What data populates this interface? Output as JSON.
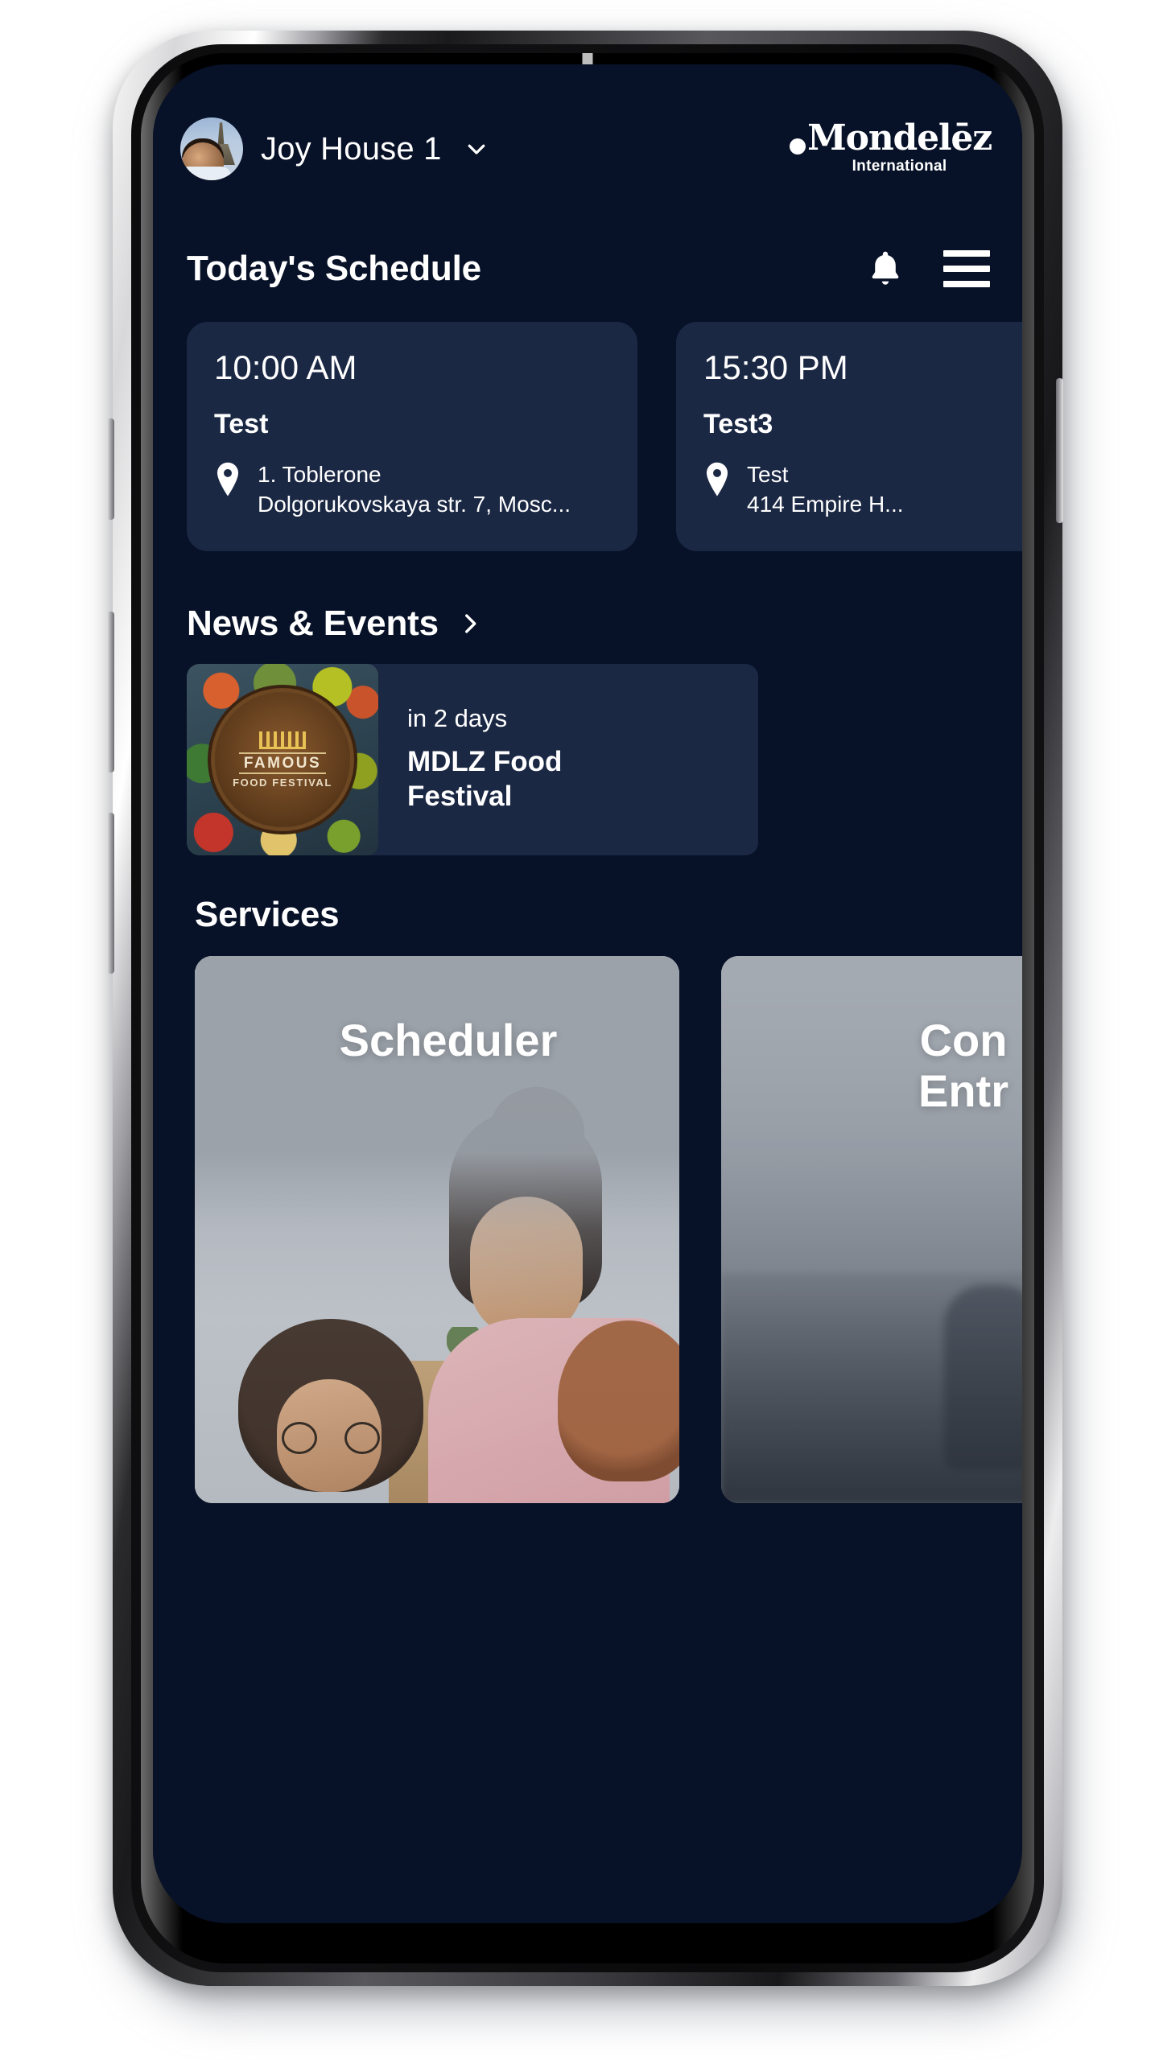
{
  "header": {
    "house_name": "Joy House 1",
    "chevron_icon": "chevron-down-icon",
    "avatar_icon": "user-avatar",
    "brand_word": "Mondelēz",
    "brand_sub": "International"
  },
  "schedule": {
    "section_title": "Today's Schedule",
    "bell_icon": "bell-icon",
    "menu_icon": "hamburger-menu-icon",
    "cards": [
      {
        "time": "10:00 AM",
        "title": "Test",
        "location_icon": "map-pin-icon",
        "location_name": "1. Toblerone",
        "location_address": "Dolgorukovskaya str. 7, Mosc..."
      },
      {
        "time": "15:30 PM",
        "title": "Test3",
        "location_icon": "map-pin-icon",
        "location_name": "Test",
        "location_address": "414 Empire H..."
      }
    ]
  },
  "news": {
    "section_title": "News & Events",
    "chevron_icon": "chevron-right-icon",
    "items": [
      {
        "thumb_line1": "FAMOUS",
        "thumb_line2": "FOOD FESTIVAL",
        "when": "in 2 days",
        "title": "MDLZ Food Festival"
      }
    ]
  },
  "services": {
    "section_title": "Services",
    "items": [
      {
        "label": "Scheduler"
      },
      {
        "label": "Con\nEntr"
      }
    ]
  },
  "colors": {
    "screen_background": "#071127",
    "card_background": "#1b2844",
    "text_primary": "#ffffff",
    "service_overlay": "#9aa0a8"
  }
}
